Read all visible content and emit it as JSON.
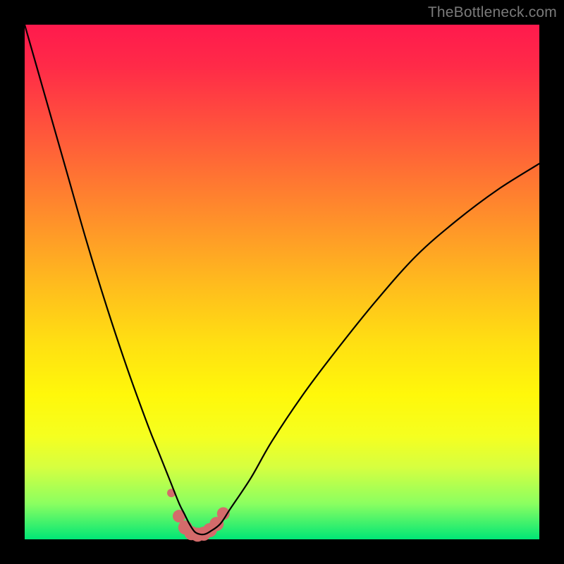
{
  "watermark": "TheBottleneck.com",
  "chart_data": {
    "type": "line",
    "title": "",
    "xlabel": "",
    "ylabel": "",
    "xlim": [
      0,
      100
    ],
    "ylim": [
      0,
      100
    ],
    "grid": false,
    "series": [
      {
        "name": "bottleneck-curve",
        "x": [
          0,
          4,
          8,
          12,
          16,
          20,
          24,
          26,
          28,
          30,
          31,
          32,
          33,
          34,
          35,
          36,
          38,
          40,
          44,
          48,
          54,
          60,
          68,
          76,
          84,
          92,
          100
        ],
        "y": [
          100,
          86,
          72,
          58,
          45,
          33,
          22,
          17,
          12,
          7,
          5,
          3,
          1.5,
          1,
          1,
          1.5,
          3,
          6,
          12,
          19,
          28,
          36,
          46,
          55,
          62,
          68,
          73
        ]
      }
    ],
    "markers": {
      "name": "highlight-dots",
      "color": "#d46b6b",
      "points": [
        {
          "x": 28.5,
          "y": 9,
          "r": 6
        },
        {
          "x": 30.0,
          "y": 4.5,
          "r": 9
        },
        {
          "x": 31.2,
          "y": 2.3,
          "r": 10
        },
        {
          "x": 32.4,
          "y": 1.2,
          "r": 10
        },
        {
          "x": 33.6,
          "y": 0.9,
          "r": 10
        },
        {
          "x": 34.8,
          "y": 1.1,
          "r": 10
        },
        {
          "x": 36.0,
          "y": 1.8,
          "r": 10
        },
        {
          "x": 37.3,
          "y": 3.0,
          "r": 10
        },
        {
          "x": 38.6,
          "y": 5.0,
          "r": 9
        }
      ]
    },
    "background_gradient": {
      "top": "#ff1a4d",
      "mid": "#ffe012",
      "bottom": "#00e676"
    }
  }
}
